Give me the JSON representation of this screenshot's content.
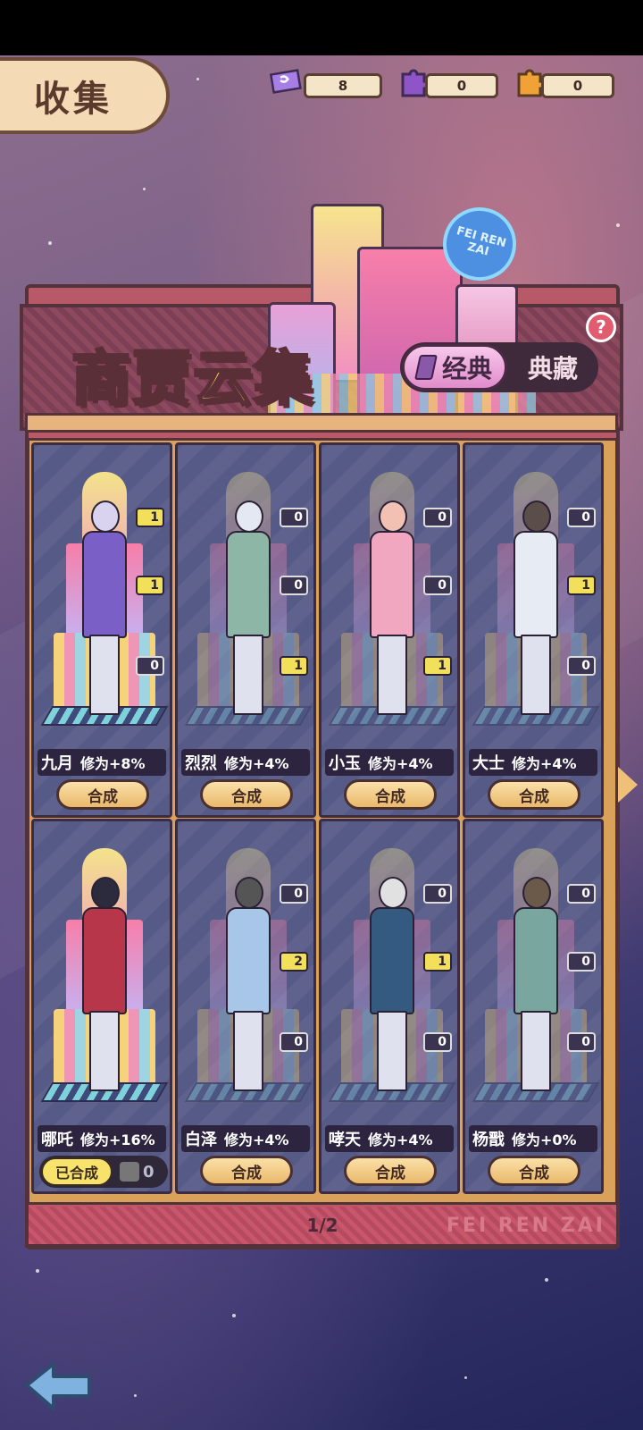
{
  "header": {
    "title": "收集",
    "currencies": [
      {
        "icon": "ticket-icon",
        "value": "8",
        "color": "#9a6fe0"
      },
      {
        "icon": "purple-puzzle-icon",
        "value": "0",
        "color": "#8e55c9"
      },
      {
        "icon": "orange-puzzle-icon",
        "value": "0",
        "color": "#f0a236"
      }
    ]
  },
  "banner": {
    "title": "商贾云集",
    "neon_sign": "FEI REN ZAI",
    "toggle": {
      "active": "经典",
      "inactive": "典藏"
    },
    "help": "?"
  },
  "cards": [
    {
      "name": "九月",
      "bonus": "修为+8%",
      "button": "合成",
      "slots": [
        "1",
        "1",
        "0"
      ],
      "lit": [
        true,
        true,
        false
      ],
      "unlocked": true,
      "hair": "#d9d3ef",
      "cloth": "#7a5fc6"
    },
    {
      "name": "烈烈",
      "bonus": "修为+4%",
      "button": "合成",
      "slots": [
        "0",
        "0",
        "1"
      ],
      "lit": [
        false,
        false,
        true
      ],
      "unlocked": false,
      "hair": "#e4e8f2",
      "cloth": "#8db6a6"
    },
    {
      "name": "小玉",
      "bonus": "修为+4%",
      "button": "合成",
      "slots": [
        "0",
        "0",
        "1"
      ],
      "lit": [
        false,
        false,
        true
      ],
      "unlocked": false,
      "hair": "#f2c1b4",
      "cloth": "#f2a7c0"
    },
    {
      "name": "大士",
      "bonus": "修为+4%",
      "button": "合成",
      "slots": [
        "0",
        "1",
        "0"
      ],
      "lit": [
        false,
        true,
        false
      ],
      "unlocked": false,
      "hair": "#5a4d4a",
      "cloth": "#e7ecf4"
    },
    {
      "name": "哪吒",
      "bonus": "修为+16%",
      "done_label": "已合成",
      "done_count": "0",
      "slots": [],
      "lit": [],
      "unlocked": true,
      "hair": "#2b2b3d",
      "cloth": "#b8364a"
    },
    {
      "name": "白泽",
      "bonus": "修为+4%",
      "button": "合成",
      "slots": [
        "0",
        "2",
        "0"
      ],
      "lit": [
        false,
        true,
        false
      ],
      "unlocked": false,
      "hair": "#555",
      "cloth": "#a7c6e8"
    },
    {
      "name": "哮天",
      "bonus": "修为+4%",
      "button": "合成",
      "slots": [
        "0",
        "1",
        "0"
      ],
      "lit": [
        false,
        true,
        false
      ],
      "unlocked": false,
      "hair": "#e1e1e1",
      "cloth": "#355a80"
    },
    {
      "name": "杨戬",
      "bonus": "修为+0%",
      "button": "合成",
      "slots": [
        "0",
        "0",
        "0"
      ],
      "lit": [
        false,
        false,
        false
      ],
      "unlocked": false,
      "hair": "#6b5a4a",
      "cloth": "#7aa6a0"
    }
  ],
  "pager": {
    "page": "1/2",
    "brand": "FEI REN ZAI"
  }
}
